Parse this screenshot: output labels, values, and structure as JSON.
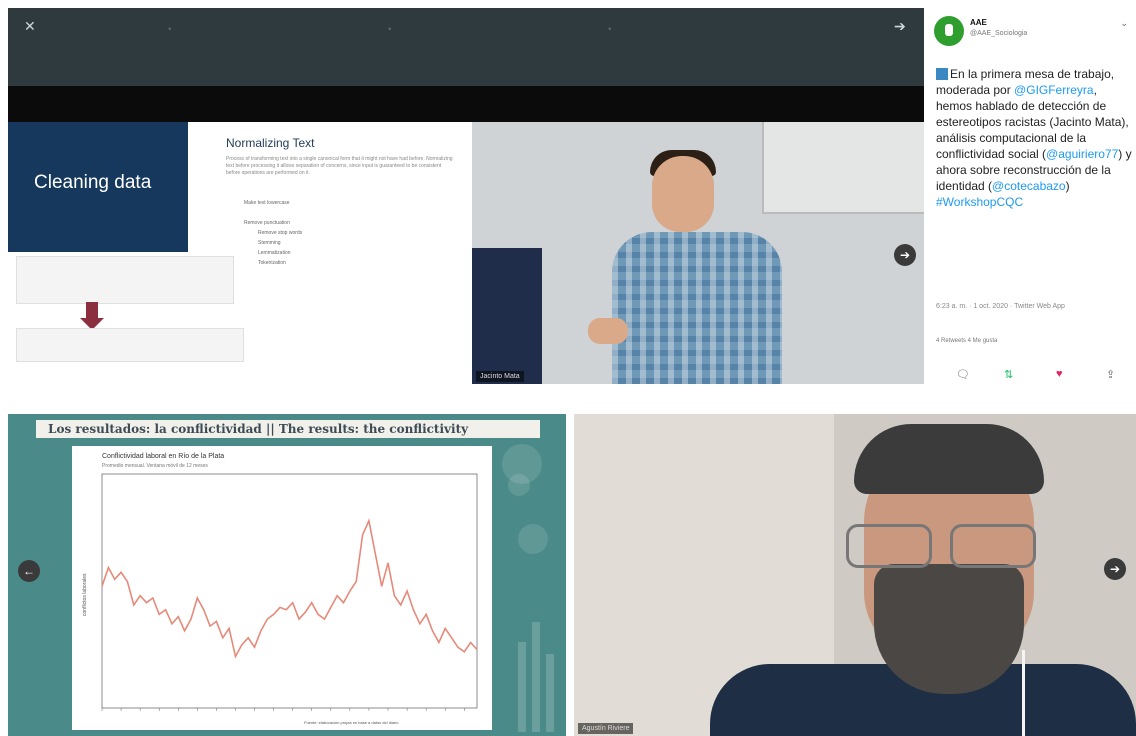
{
  "slide1": {
    "title": "Cleaning data",
    "heading": "Normalizing Text",
    "paragraph": "Process of transforming text into a single canonical form that it might not have had before. Normalizing text before processing it allows separation of concerns, since input is guaranteed to be consistent before operations are performed on it.",
    "bullets": [
      "Make text lowercase",
      "Remove punctuation",
      "Remove stop words",
      "Stemming",
      "Lemmatization",
      "Tokenization"
    ]
  },
  "video1": {
    "participant_label": "Jacinto Mata"
  },
  "tweet": {
    "account_name": "AAE",
    "account_handle": "@AAE_Sociologia",
    "text_before": "En la primera mesa de trabajo, moderada por ",
    "mention1": "@GIGFerreyra",
    "text2": ", hemos hablado de detección de estereotipos racistas (Jacinto Mata), análisis computacional de la conflictividad social (",
    "mention2": "@aguiriero77",
    "text3": ") y ahora sobre reconstrucción de la identidad (",
    "mention3": "@cotecabazo",
    "text4": ") ",
    "hashtag": "#WorkshopCQC",
    "meta": "6:23 a. m. · 1 oct. 2020 · Twitter Web App",
    "stats": "4 Retweets   4 Me gusta",
    "actions": [
      "reply",
      "retweet",
      "like",
      "share"
    ]
  },
  "slide2": {
    "title": "Los resultados: la conflictividad || The results: the conflictivity",
    "chart_title": "Conflictividad laboral en Río de la Plata",
    "chart_subtitle": "Promedio mensual. Ventana móvil de 12 meses",
    "ylabel": "conflictos laborales",
    "source": "Fuente: elaboración propia en base a datos del diario"
  },
  "video2": {
    "participant_label": "Agustín Riviere"
  },
  "colors": {
    "accent_teal": "#4a8a88",
    "navy": "#16385c",
    "chart_line": "#e58a7a",
    "twitter_blue": "#1d9bf0",
    "like_red": "#e0245e"
  },
  "chart_data": {
    "type": "line",
    "title": "Conflictividad laboral en Río de la Plata",
    "ylabel": "conflictos laborales",
    "x": [
      0,
      1,
      2,
      3,
      4,
      5,
      6,
      7,
      8,
      9,
      10,
      11,
      12,
      13,
      14,
      15,
      16,
      17,
      18,
      19,
      20,
      21,
      22,
      23,
      24,
      25,
      26,
      27,
      28,
      29,
      30,
      31,
      32,
      33,
      34,
      35,
      36,
      37,
      38,
      39,
      40,
      41,
      42,
      43,
      44,
      45,
      46,
      47,
      48,
      49,
      50,
      51,
      52,
      53,
      54,
      55,
      56,
      57,
      58,
      59
    ],
    "series": [
      {
        "values": [
          52,
          60,
          55,
          58,
          54,
          44,
          48,
          45,
          47,
          40,
          42,
          36,
          39,
          33,
          38,
          47,
          42,
          35,
          37,
          30,
          34,
          22,
          27,
          30,
          26,
          33,
          38,
          40,
          43,
          42,
          45,
          38,
          41,
          45,
          40,
          38,
          43,
          48,
          45,
          50,
          54,
          74,
          80,
          66,
          52,
          62,
          48,
          44,
          50,
          42,
          36,
          40,
          33,
          28,
          34,
          30,
          26,
          24,
          28,
          25
        ]
      }
    ],
    "ylim": [
      0,
      100
    ],
    "grid": false
  }
}
